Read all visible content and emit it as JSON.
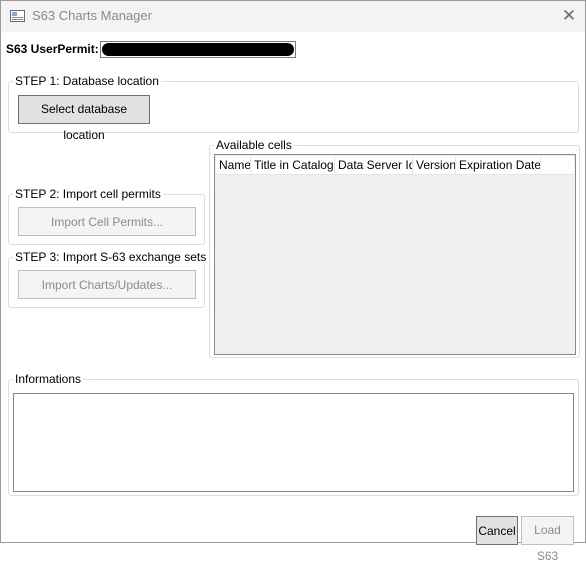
{
  "window": {
    "title": "S63 Charts Manager",
    "icon": "app-icon",
    "close_symbol": "✕"
  },
  "permit": {
    "label": "S63 UserPermit:",
    "value_redacted": true
  },
  "step1": {
    "title": "STEP 1: Database location",
    "button": "Select database location"
  },
  "step2": {
    "title": "STEP 2: Import cell permits",
    "button": "Import Cell Permits..."
  },
  "step3": {
    "title": "STEP 3: Import S-63 exchange sets",
    "button": "Import Charts/Updates..."
  },
  "cells": {
    "title": "Available cells",
    "columns": [
      "Name",
      "Title in Catalog",
      "Data Server Id",
      "Version",
      "Expiration Date"
    ],
    "rows": []
  },
  "info": {
    "title": "Informations",
    "text": ""
  },
  "footer": {
    "cancel": "Cancel",
    "load": "Load S63"
  }
}
